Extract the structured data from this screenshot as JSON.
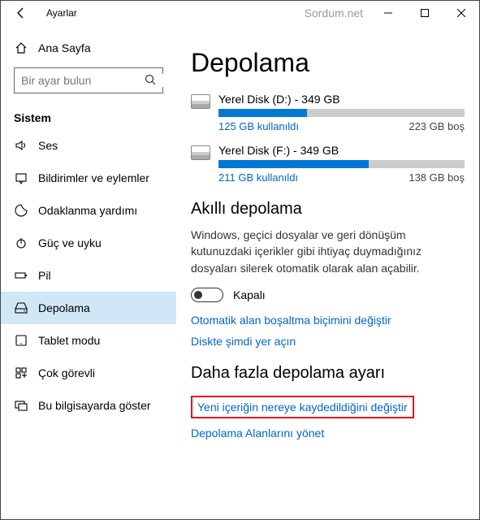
{
  "titlebar": {
    "title": "Ayarlar",
    "watermark": "Sordum.net"
  },
  "sidebar": {
    "home": "Ana Sayfa",
    "search_placeholder": "Bir ayar bulun",
    "section": "Sistem",
    "items": [
      {
        "label": "Ses"
      },
      {
        "label": "Bildirimler ve eylemler"
      },
      {
        "label": "Odaklanma yardımı"
      },
      {
        "label": "Güç ve uyku"
      },
      {
        "label": "Pil"
      },
      {
        "label": "Depolama"
      },
      {
        "label": "Tablet modu"
      },
      {
        "label": "Çok görevli"
      },
      {
        "label": "Bu bilgisayarda göster"
      }
    ]
  },
  "main": {
    "title": "Depolama",
    "disks": [
      {
        "name": "Yerel Disk (D:) - 349 GB",
        "used": "125 GB kullanıldı",
        "free": "223 GB boş",
        "fill": 36
      },
      {
        "name": "Yerel Disk (F:) - 349 GB",
        "used": "211 GB kullanıldı",
        "free": "138 GB boş",
        "fill": 61
      }
    ],
    "smart_title": "Akıllı depolama",
    "smart_desc": "Windows, geçici dosyalar ve geri dönüşüm kutunuzdaki içerikler gibi ihtiyaç duymadığınız dosyaları silerek otomatik olarak alan açabilir.",
    "toggle_state": "Kapalı",
    "link1": "Otomatik alan boşaltma biçimini değiştir",
    "link2": "Diskte şimdi yer açın",
    "more_title": "Daha fazla depolama ayarı",
    "more_link1": "Yeni içeriğin nereye kaydedildiğini değiştir",
    "more_link2": "Depolama Alanlarını yönet"
  }
}
